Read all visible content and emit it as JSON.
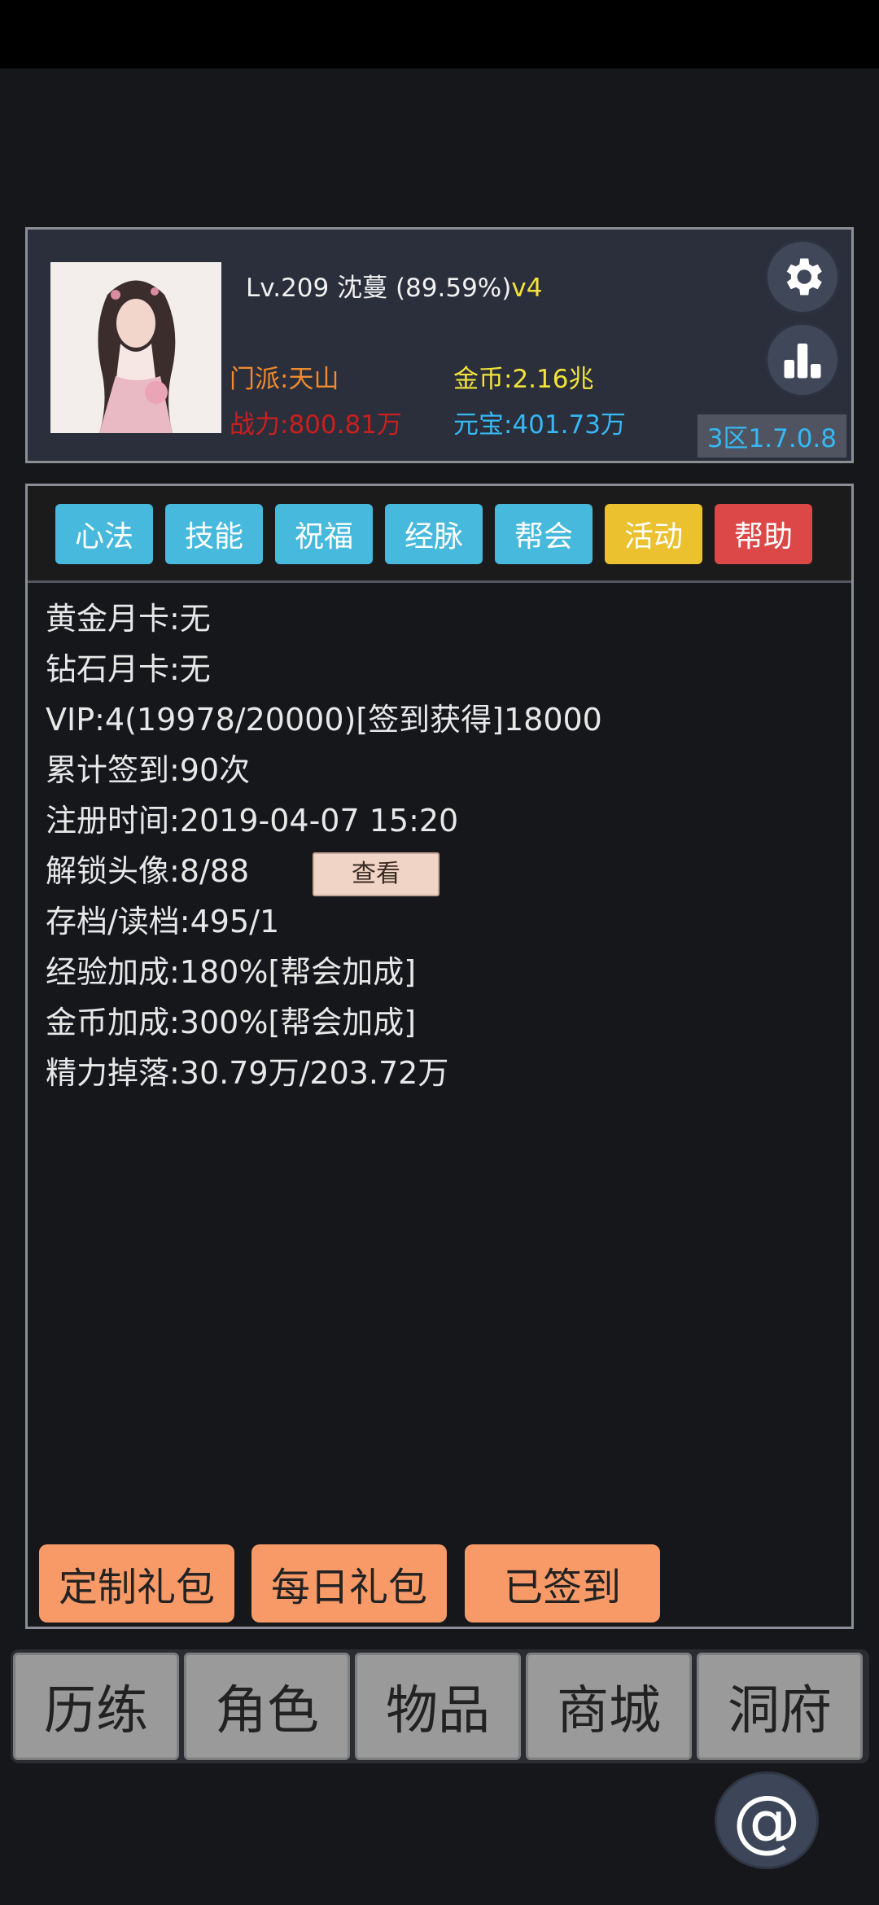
{
  "profile": {
    "level": "Lv.209",
    "name": "沈蔓",
    "exp_percent": "(89.59%)",
    "vip_tag": "v4",
    "sect": "门派:天山",
    "power": "战力:800.81万",
    "gold": "金币:2.16兆",
    "yuanbao": "元宝:401.73万",
    "version": "3区1.7.0.8"
  },
  "tabs": [
    {
      "label": "心法"
    },
    {
      "label": "技能"
    },
    {
      "label": "祝福"
    },
    {
      "label": "经脉"
    },
    {
      "label": "帮会"
    },
    {
      "label": "活动"
    },
    {
      "label": "帮助"
    }
  ],
  "info": {
    "gold_month_card": "黄金月卡:无",
    "diamond_month_card": "钻石月卡:无",
    "vip": "VIP:4(19978/20000)[签到获得]18000",
    "checkins": "累计签到:90次",
    "register_time": "注册时间:2019-04-07 15:20",
    "avatars_unlocked": "解锁头像:8/88",
    "view_button": "查看",
    "save_load": "存档/读档:495/1",
    "exp_bonus": "经验加成:180%[帮会加成]",
    "gold_bonus": "金币加成:300%[帮会加成]",
    "energy_drop": "精力掉落:30.79万/203.72万"
  },
  "gifts": {
    "custom": "定制礼包",
    "daily": "每日礼包",
    "signed": "已签到"
  },
  "nav": [
    {
      "label": "历练"
    },
    {
      "label": "角色"
    },
    {
      "label": "物品"
    },
    {
      "label": "商城"
    },
    {
      "label": "洞府"
    }
  ],
  "icons": {
    "settings": "gear-icon",
    "ranking": "bar-chart-icon",
    "mention": "at-icon"
  },
  "colors": {
    "tab_blue": "#46b9dd",
    "tab_yellow": "#ebc12f",
    "tab_red": "#dc4848",
    "gift_orange": "#f79a68"
  }
}
